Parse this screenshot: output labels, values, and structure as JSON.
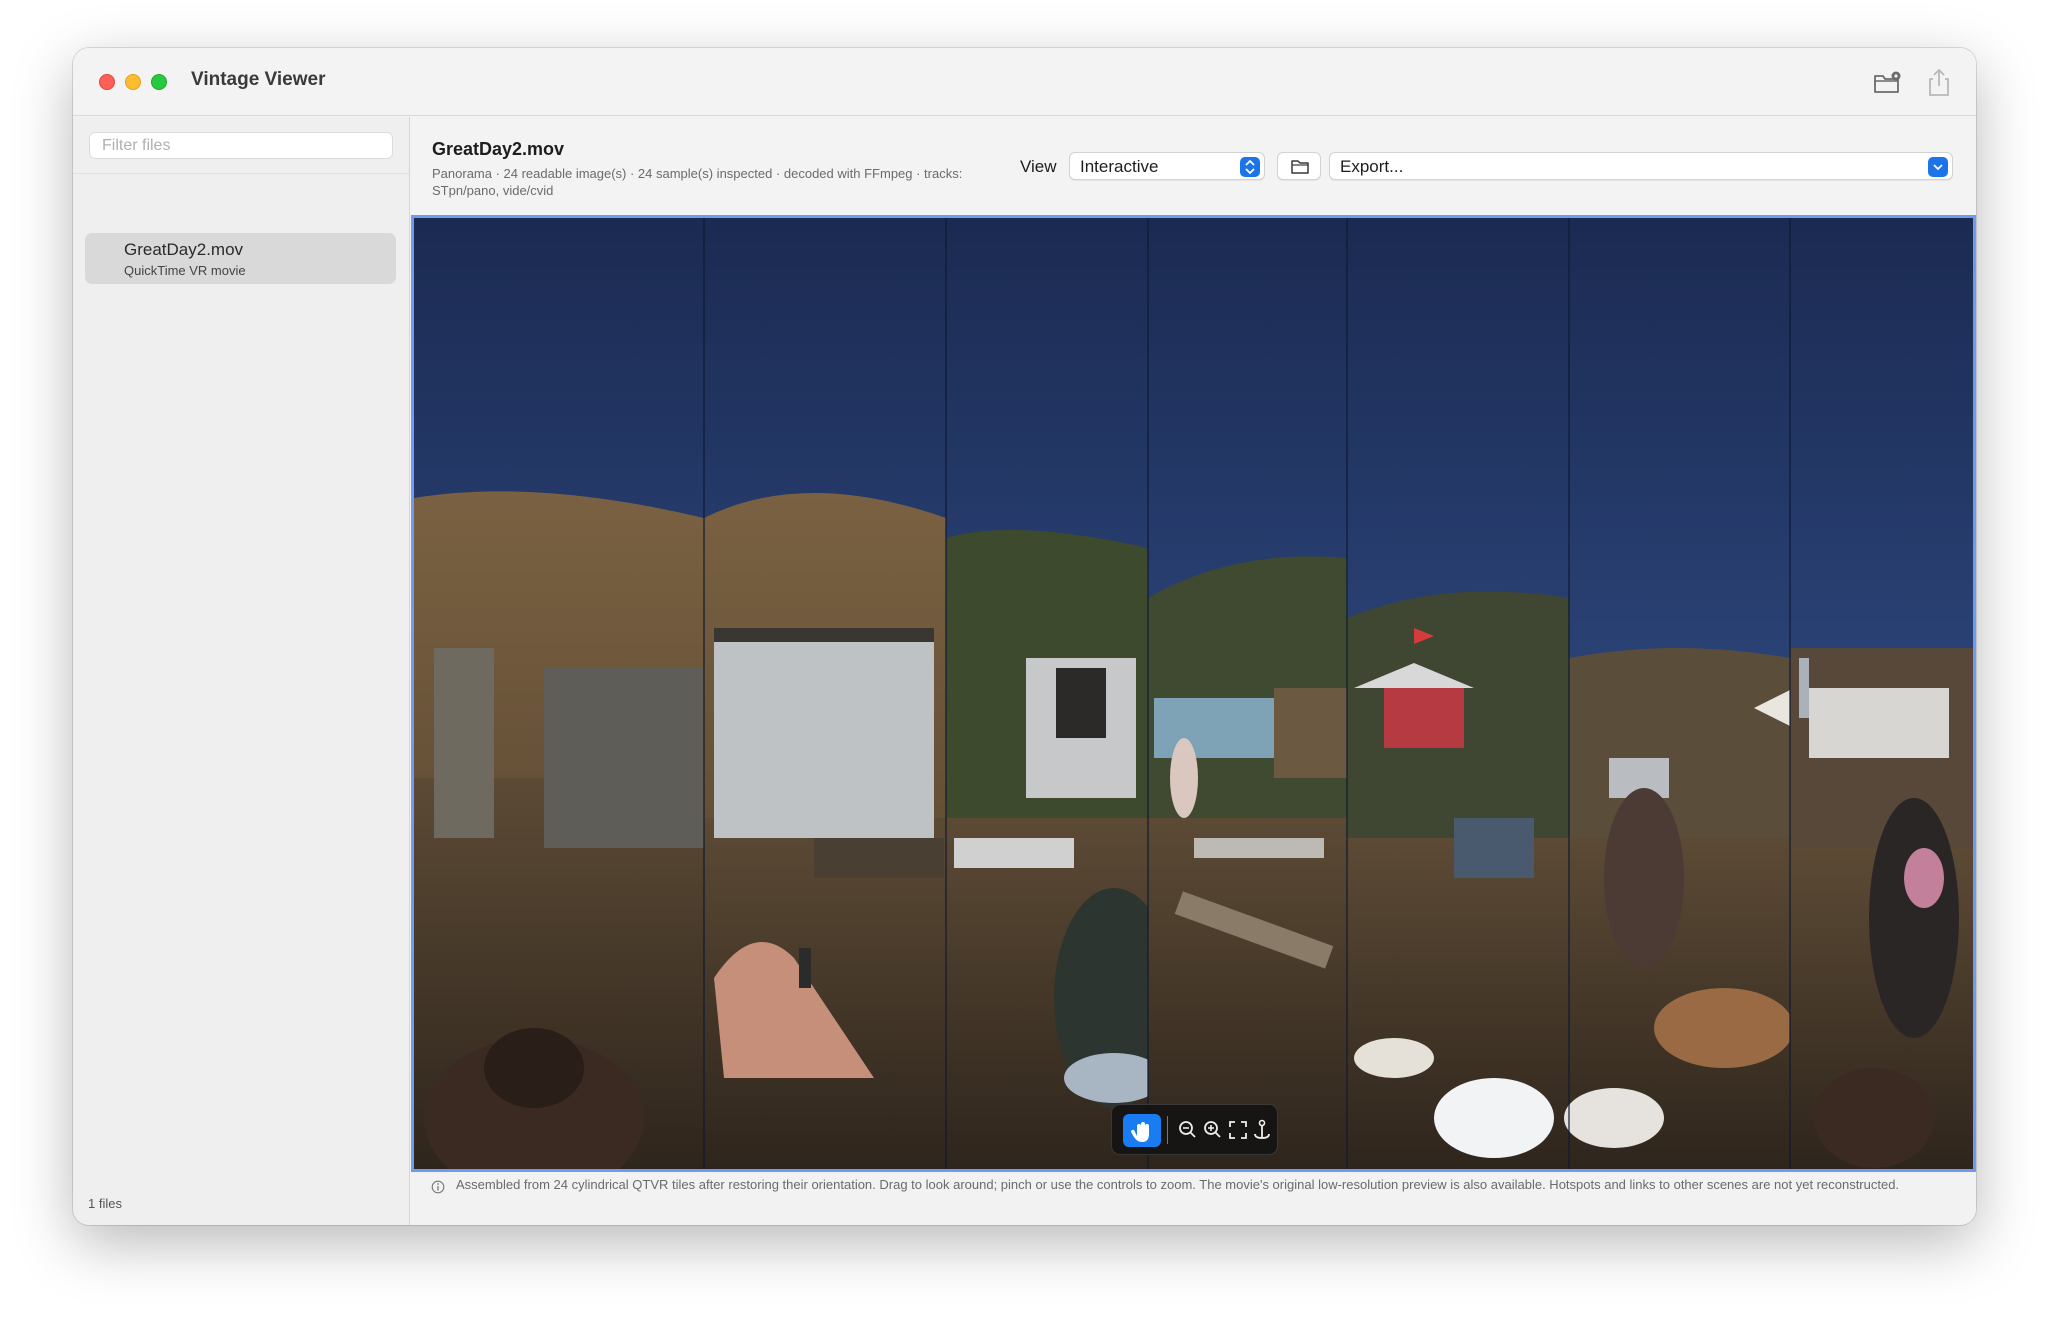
{
  "app": {
    "title": "Vintage Viewer"
  },
  "titlebar": {
    "new_folder_icon": "folder-badge-icon",
    "share_icon": "share-icon"
  },
  "sidebar": {
    "filter_placeholder": "Filter files",
    "items": [
      {
        "name": "GreatDay2.mov",
        "kind": "QuickTime VR movie",
        "selected": true
      }
    ],
    "count_label": "1 files"
  },
  "header": {
    "title": "GreatDay2.mov",
    "meta": "Panorama · 24 readable image(s) · 24 sample(s) inspected · decoded with FFmpeg · tracks: STpn/pano, vide/cvid",
    "view_label": "View",
    "view_value": "Interactive",
    "export_value": "Export..."
  },
  "viewer": {
    "toolbar": [
      "hand-icon",
      "zoom-out-icon",
      "zoom-in-icon",
      "fit-screen-icon",
      "anchor-icon"
    ],
    "accent": "#1a7cf2",
    "border": "#6e9bf0"
  },
  "footer": {
    "note": "Assembled from 24 cylindrical QTVR tiles after restoring their orientation. Drag to look around; pinch or use the controls to zoom. The movie's original low-resolution preview is also available. Hotspots and links to other scenes are not yet reconstructed."
  }
}
